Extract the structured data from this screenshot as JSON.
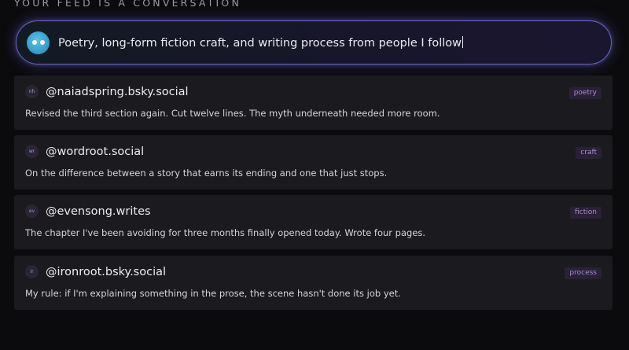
{
  "heading": "YOUR FEED IS A CONVERSATION",
  "prompt": {
    "value": "Poetry, long-form fiction craft, and writing process from people I follow"
  },
  "posts": [
    {
      "avatar_initials": "nh",
      "handle": "@naiadspring.bsky.social",
      "tag": "poetry",
      "text": "Revised the third section again. Cut twelve lines. The myth underneath needed more room."
    },
    {
      "avatar_initials": "wr",
      "handle": "@wordroot.social",
      "tag": "craft",
      "text": "On the difference between a story that earns its ending and one that just stops."
    },
    {
      "avatar_initials": "ev",
      "handle": "@evensong.writes",
      "tag": "fiction",
      "text": "The chapter I've been avoiding for three months finally opened today. Wrote four pages."
    },
    {
      "avatar_initials": "ir",
      "handle": "@ironroot.bsky.social",
      "tag": "process",
      "text": "My rule: if I'm explaining something in the prose, the scene hasn't done its job yet."
    }
  ]
}
